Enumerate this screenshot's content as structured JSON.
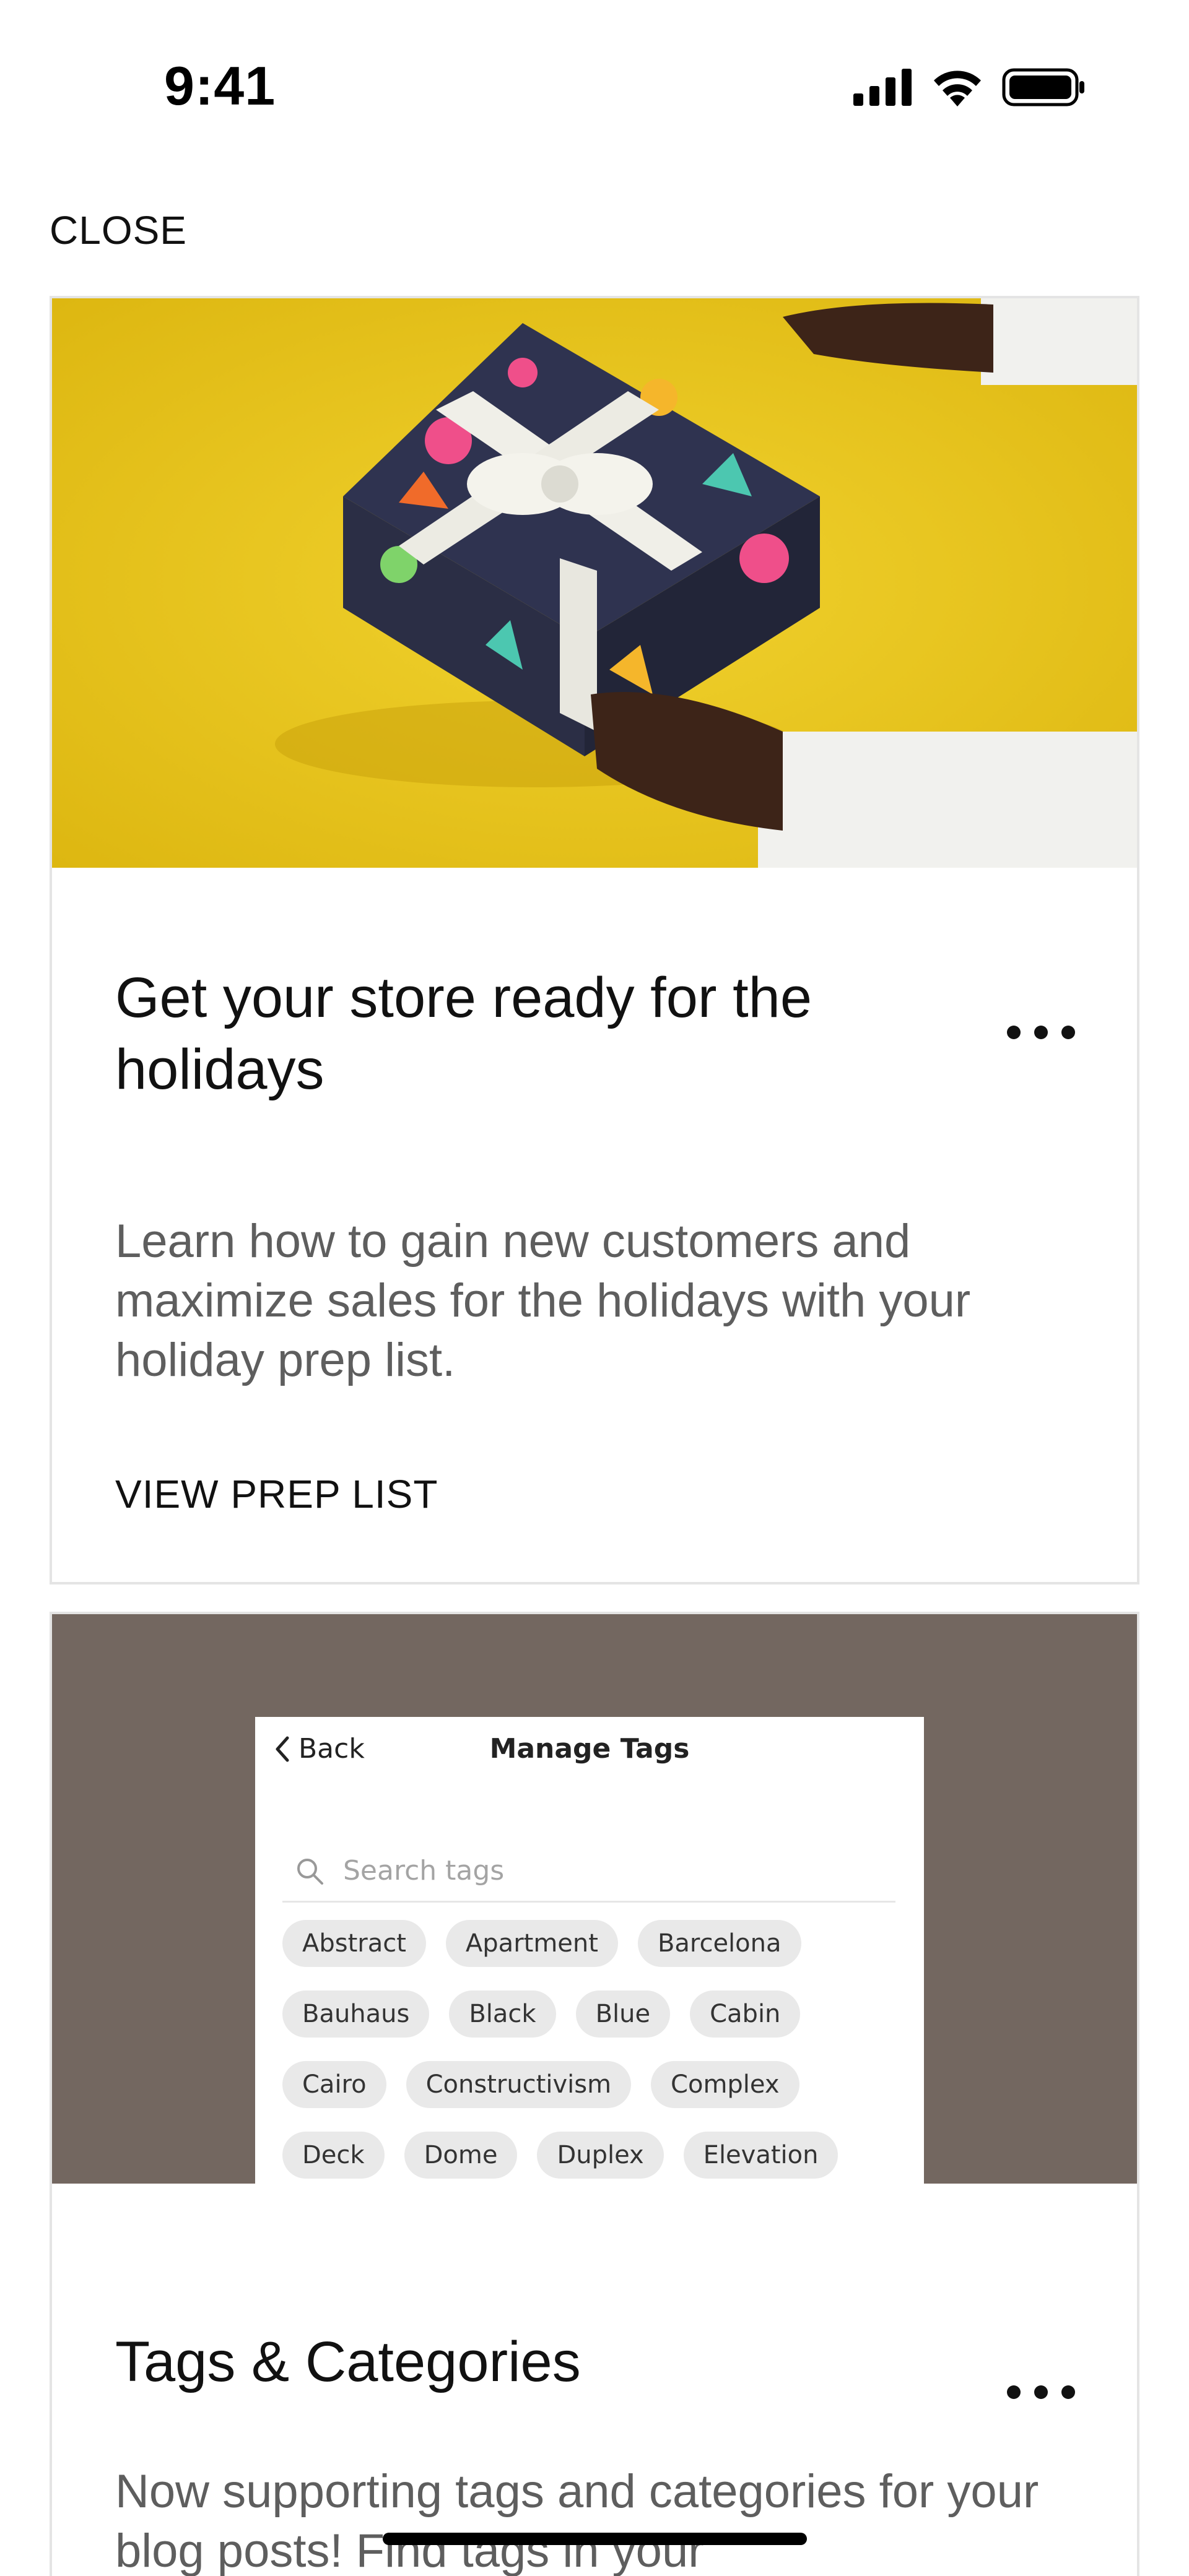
{
  "status_bar": {
    "time": "9:41"
  },
  "close_label": "CLOSE",
  "cards": [
    {
      "title": "Get your store ready for the holidays",
      "description": "Learn how to gain new customers and maximize sales for the holidays with your holiday prep list.",
      "cta": "VIEW PREP LIST",
      "image_bg": "#e8c51c"
    },
    {
      "title": "Tags & Categories",
      "description": "Now supporting tags and categories for your blog posts! Find tags in your",
      "image_bg": "#736760",
      "mock": {
        "back_label": "Back",
        "title": "Manage Tags",
        "search_placeholder": "Search tags",
        "tags": [
          [
            "Abstract",
            "Apartment",
            "Barcelona"
          ],
          [
            "Bauhaus",
            "Black",
            "Blue",
            "Cabin"
          ],
          [
            "Cairo",
            "Constructivism",
            "Complex"
          ],
          [
            "Deck",
            "Dome",
            "Duplex",
            "Elevation"
          ]
        ]
      }
    }
  ]
}
